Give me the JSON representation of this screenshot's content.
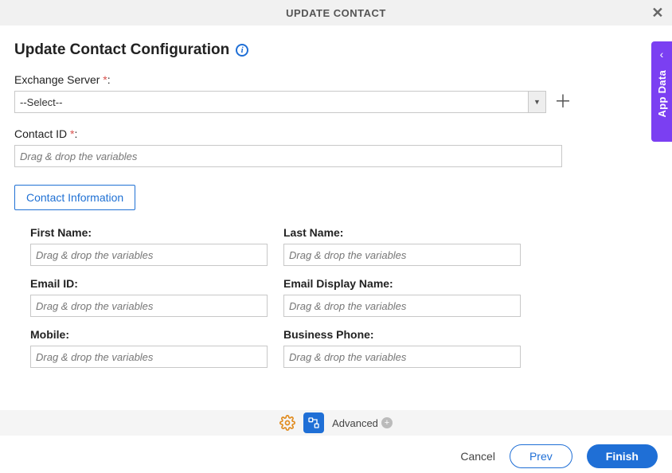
{
  "header": {
    "title": "UPDATE CONTACT"
  },
  "page": {
    "title": "Update Contact Configuration"
  },
  "fields": {
    "exchange_label": "Exchange Server",
    "exchange_value": "--Select--",
    "contact_id_label": "Contact ID",
    "contact_id_placeholder": "Drag & drop the variables",
    "required_marker": "*",
    "colon": ":"
  },
  "tabs": {
    "contact_info": "Contact Information"
  },
  "form": {
    "placeholder": "Drag & drop the variables",
    "left": [
      {
        "label": "First Name:"
      },
      {
        "label": "Email ID:"
      },
      {
        "label": "Mobile:"
      }
    ],
    "right": [
      {
        "label": "Last Name:"
      },
      {
        "label": "Email Display Name:"
      },
      {
        "label": "Business Phone:"
      }
    ]
  },
  "side_tab": {
    "label": "App Data"
  },
  "footer_bar": {
    "advanced": "Advanced"
  },
  "actions": {
    "cancel": "Cancel",
    "prev": "Prev",
    "finish": "Finish"
  }
}
